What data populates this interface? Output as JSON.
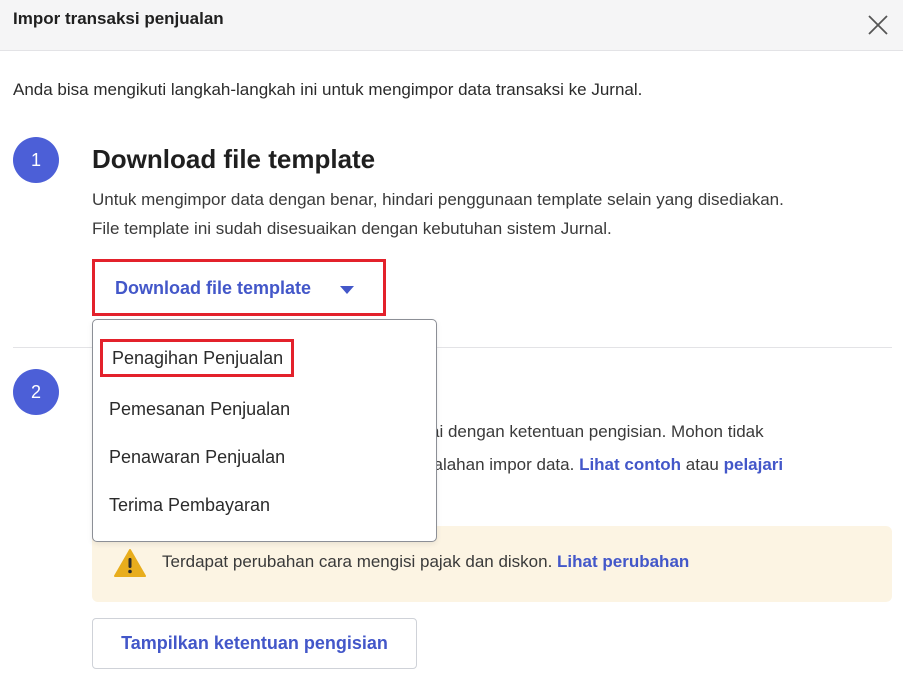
{
  "header": {
    "title": "Impor transaksi penjualan"
  },
  "intro": "Anda bisa mengikuti langkah-langkah ini untuk mengimpor data transaksi ke Jurnal.",
  "step1": {
    "number": "1",
    "title": "Download file template",
    "description_line1": "Untuk mengimpor data dengan benar, hindari penggunaan template selain yang disediakan.",
    "description_line2": "File template ini sudah disesuaikan dengan kebutuhan sistem Jurnal.",
    "download_button_label": "Download file template"
  },
  "dropdown": {
    "items": [
      {
        "label": "Penagihan Penjualan",
        "highlighted": true
      },
      {
        "label": "Pemesanan Penjualan"
      },
      {
        "label": "Penawaran Penjualan"
      },
      {
        "label": "Terima Pembayaran"
      }
    ]
  },
  "step2": {
    "number": "2",
    "line1_visible": "ai dengan ketentuan pengisian. Mohon tidak",
    "line2_visible_prefix": "salahan impor data.",
    "link_example": "Lihat contoh",
    "connector": "atau",
    "link_learn": "pelajari"
  },
  "warning": {
    "text": "Terdapat perubahan cara mengisi pajak dan diskon.",
    "link": "Lihat perubahan",
    "color": "#fcf4e3",
    "icon_color": "#e8ad1d"
  },
  "show_rules_button_label": "Tampilkan ketentuan pengisian",
  "colors": {
    "accent": "#4357c9",
    "step_circle": "#4c5fd7",
    "highlight": "#e3212b"
  }
}
